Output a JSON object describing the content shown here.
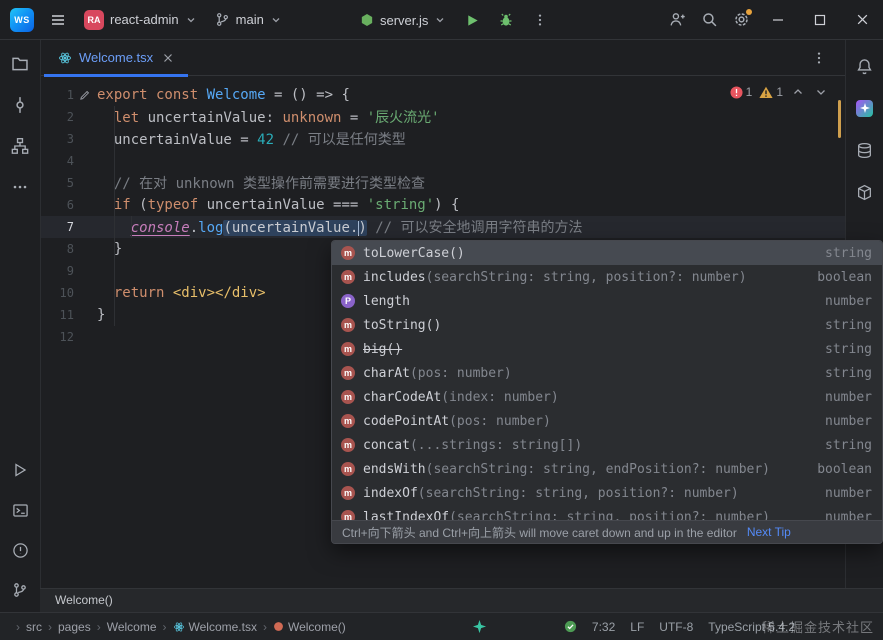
{
  "colors": {
    "accent_blue": "#3574f0",
    "error_red": "#e8555f",
    "warning_yellow": "#d9a343",
    "keyword_orange": "#cf8e6d",
    "string_green": "#6aab73",
    "number_teal": "#2aacb8",
    "comment_gray": "#7a7e85",
    "editor_bg": "#1e1f22",
    "popup_bg": "#2b2d30"
  },
  "title_bar": {
    "logo": "WS",
    "project_avatar": "RA",
    "project_name": "react-admin",
    "branch_name": "main",
    "run_config": "server.js"
  },
  "tab_bar": {
    "tabs": [
      {
        "label": "Welcome.tsx",
        "active": true
      }
    ]
  },
  "inspections": {
    "errors": "1",
    "warnings": "1"
  },
  "editor": {
    "lines": [
      {
        "num": "1",
        "gutter_icon": true,
        "segs": [
          [
            "kw",
            "export const "
          ],
          [
            "fn",
            "Welcome"
          ],
          [
            "pl",
            " = () => {"
          ]
        ]
      },
      {
        "num": "2",
        "segs": [
          [
            "pl",
            "  "
          ],
          [
            "kw",
            "let "
          ],
          [
            "pl",
            "uncertainValue: "
          ],
          [
            "kw",
            "unknown"
          ],
          [
            "pl",
            " = "
          ],
          [
            "str",
            "'辰火流光'"
          ]
        ]
      },
      {
        "num": "3",
        "segs": [
          [
            "pl",
            "  uncertainValue = "
          ],
          [
            "num",
            "42"
          ],
          [
            "pl",
            " "
          ],
          [
            "cmt",
            "// 可以是任何类型"
          ]
        ]
      },
      {
        "num": "4",
        "segs": []
      },
      {
        "num": "5",
        "segs": [
          [
            "pl",
            "  "
          ],
          [
            "cmt",
            "// 在对 unknown 类型操作前需要进行类型检查"
          ]
        ]
      },
      {
        "num": "6",
        "segs": [
          [
            "pl",
            "  "
          ],
          [
            "kw",
            "if"
          ],
          [
            "pl",
            " ("
          ],
          [
            "kw",
            "typeof"
          ],
          [
            "pl",
            " uncertainValue === "
          ],
          [
            "str",
            "'string'"
          ],
          [
            "pl",
            ") {"
          ]
        ]
      },
      {
        "num": "7",
        "current": true,
        "segs": [
          [
            "pl",
            "    "
          ],
          [
            "global",
            "console"
          ],
          [
            "pl",
            "."
          ],
          [
            "fncall",
            "log"
          ],
          [
            "hl",
            "(uncertainValue."
          ],
          [
            "caret",
            ""
          ],
          [
            "hl",
            ")"
          ],
          [
            "pl",
            " "
          ],
          [
            "cmt",
            "// 可以安全地调用字符串的方法"
          ]
        ]
      },
      {
        "num": "8",
        "segs": [
          [
            "pl",
            "  }"
          ]
        ]
      },
      {
        "num": "9",
        "segs": []
      },
      {
        "num": "10",
        "segs": [
          [
            "pl",
            "  "
          ],
          [
            "kw",
            "return"
          ],
          [
            "pl",
            " "
          ],
          [
            "tag",
            "<div></div>"
          ]
        ]
      },
      {
        "num": "11",
        "segs": [
          [
            "pl",
            "}"
          ]
        ]
      },
      {
        "num": "12",
        "segs": []
      }
    ]
  },
  "completion": {
    "items": [
      {
        "kind": "m",
        "name": "toLowerCase()",
        "params": "",
        "type": "string",
        "selected": true
      },
      {
        "kind": "m",
        "name": "includes",
        "params": "(searchString: string, position?: number)",
        "type": "boolean"
      },
      {
        "kind": "p",
        "name": "length",
        "params": "",
        "type": "number"
      },
      {
        "kind": "m",
        "name": "toString()",
        "params": "",
        "type": "string"
      },
      {
        "kind": "m",
        "name": "big()",
        "params": "",
        "type": "string",
        "deprecated": true
      },
      {
        "kind": "m",
        "name": "charAt",
        "params": "(pos: number)",
        "type": "string"
      },
      {
        "kind": "m",
        "name": "charCodeAt",
        "params": "(index: number)",
        "type": "number"
      },
      {
        "kind": "m",
        "name": "codePointAt",
        "params": "(pos: number)",
        "type": "number"
      },
      {
        "kind": "m",
        "name": "concat",
        "params": "(...strings: string[])",
        "type": "string"
      },
      {
        "kind": "m",
        "name": "endsWith",
        "params": "(searchString: string, endPosition?: number)",
        "type": "boolean"
      },
      {
        "kind": "m",
        "name": "indexOf",
        "params": "(searchString: string, position?: number)",
        "type": "number"
      },
      {
        "kind": "m",
        "name": "lastIndexOf",
        "params": "(searchString: string, position?: number)",
        "type": "number"
      }
    ],
    "hint_text": "Ctrl+向下箭头 and Ctrl+向上箭头 will move caret down and up in the editor",
    "next_tip_label": "Next Tip"
  },
  "context_bar": {
    "label": "Welcome()"
  },
  "status_bar": {
    "breadcrumbs": [
      {
        "label": "src",
        "icon": ""
      },
      {
        "label": "pages",
        "icon": ""
      },
      {
        "label": "Welcome",
        "icon": ""
      },
      {
        "label": "Welcome.tsx",
        "icon": "tsx"
      },
      {
        "label": "Welcome()",
        "icon": "fn"
      }
    ],
    "caret_position": "7:32",
    "line_separator": "LF",
    "encoding": "UTF-8",
    "file_type": "TypeScript 5.4.2",
    "watermark": "稀土掘金技术社区"
  }
}
